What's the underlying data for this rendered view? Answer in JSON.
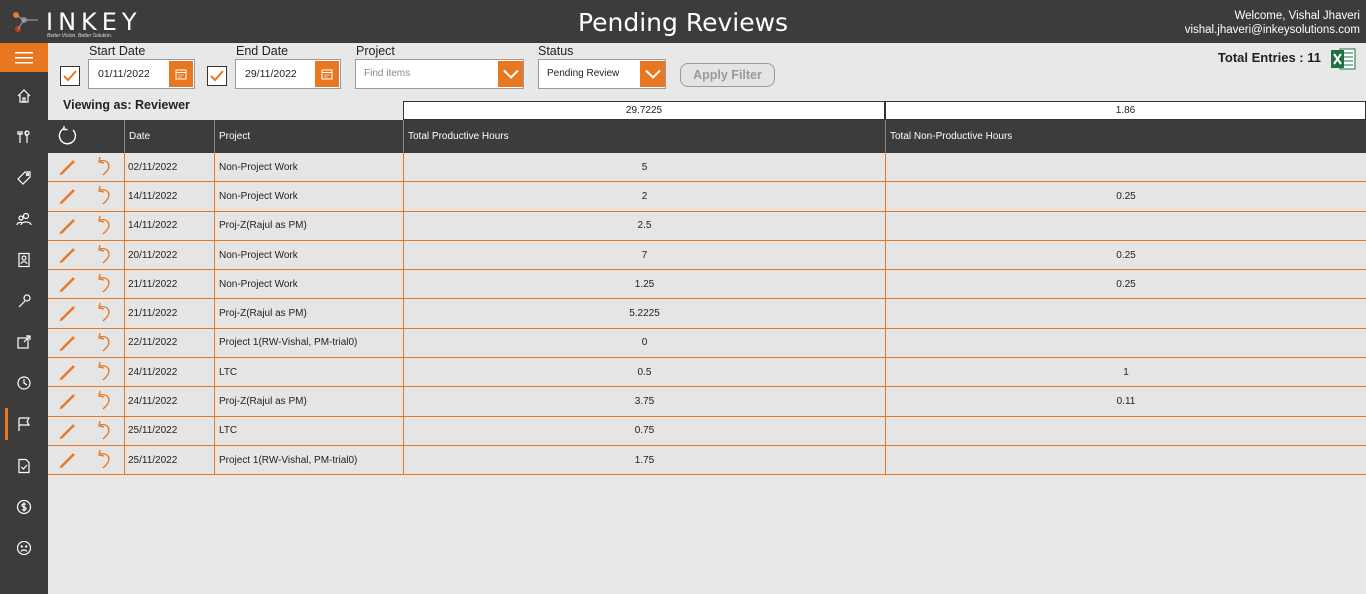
{
  "header": {
    "logo_text": "INKEY",
    "logo_tagline": "Better Vision. Better Solution.",
    "title": "Pending Reviews",
    "welcome": "Welcome, Vishal Jhaveri",
    "email": "vishal.jhaveri@inkeysolutions.com"
  },
  "sidebar": {
    "items": [
      {
        "icon": "home-icon"
      },
      {
        "icon": "tools-icon"
      },
      {
        "icon": "tag-icon"
      },
      {
        "icon": "people-icon"
      },
      {
        "icon": "contact-card-icon"
      },
      {
        "icon": "wrench-icon"
      },
      {
        "icon": "edit-external-icon"
      },
      {
        "icon": "clock-icon"
      },
      {
        "icon": "flag-icon",
        "active": true
      },
      {
        "icon": "document-check-icon"
      },
      {
        "icon": "dollar-icon"
      },
      {
        "icon": "sad-face-icon"
      }
    ]
  },
  "filters": {
    "start_date_label": "Start Date",
    "start_date_value": "01/11/2022",
    "start_checked": true,
    "end_date_label": "End Date",
    "end_date_value": "29/11/2022",
    "end_checked": true,
    "project_label": "Project",
    "project_placeholder": "Find items",
    "status_label": "Status",
    "status_value": "Pending Review",
    "apply_label": "Apply Filter"
  },
  "total_entries": "Total Entries : 11",
  "viewing_as": "Viewing as: Reviewer",
  "summary": {
    "productive_total": "29.7225",
    "nonproductive_total": "1.86"
  },
  "table": {
    "columns": [
      "Date",
      "Project",
      "Total Productive Hours",
      "Total Non-Productive Hours"
    ],
    "rows": [
      {
        "date": "02/11/2022",
        "project": "Non-Project Work",
        "productive": "5",
        "nonproductive": ""
      },
      {
        "date": "14/11/2022",
        "project": "Non-Project Work",
        "productive": "2",
        "nonproductive": "0.25"
      },
      {
        "date": "14/11/2022",
        "project": "Proj-Z(Rajul as PM)",
        "productive": "2.5",
        "nonproductive": ""
      },
      {
        "date": "20/11/2022",
        "project": "Non-Project Work",
        "productive": "7",
        "nonproductive": "0.25"
      },
      {
        "date": "21/11/2022",
        "project": "Non-Project Work",
        "productive": "1.25",
        "nonproductive": "0.25"
      },
      {
        "date": "21/11/2022",
        "project": "Proj-Z(Rajul as PM)",
        "productive": "5.2225",
        "nonproductive": ""
      },
      {
        "date": "22/11/2022",
        "project": "Project 1(RW-Vishal, PM-trial0)",
        "productive": "0",
        "nonproductive": ""
      },
      {
        "date": "24/11/2022",
        "project": "LTC",
        "productive": "0.5",
        "nonproductive": "1"
      },
      {
        "date": "24/11/2022",
        "project": "Proj-Z(Rajul as PM)",
        "productive": "3.75",
        "nonproductive": "0.11"
      },
      {
        "date": "25/11/2022",
        "project": "LTC",
        "productive": "0.75",
        "nonproductive": ""
      },
      {
        "date": "25/11/2022",
        "project": "Project 1(RW-Vishal, PM-trial0)",
        "productive": "1.75",
        "nonproductive": ""
      }
    ]
  },
  "colors": {
    "accent": "#e87722",
    "dark": "#3c3c3c",
    "row_bg": "#e5e5e5"
  }
}
